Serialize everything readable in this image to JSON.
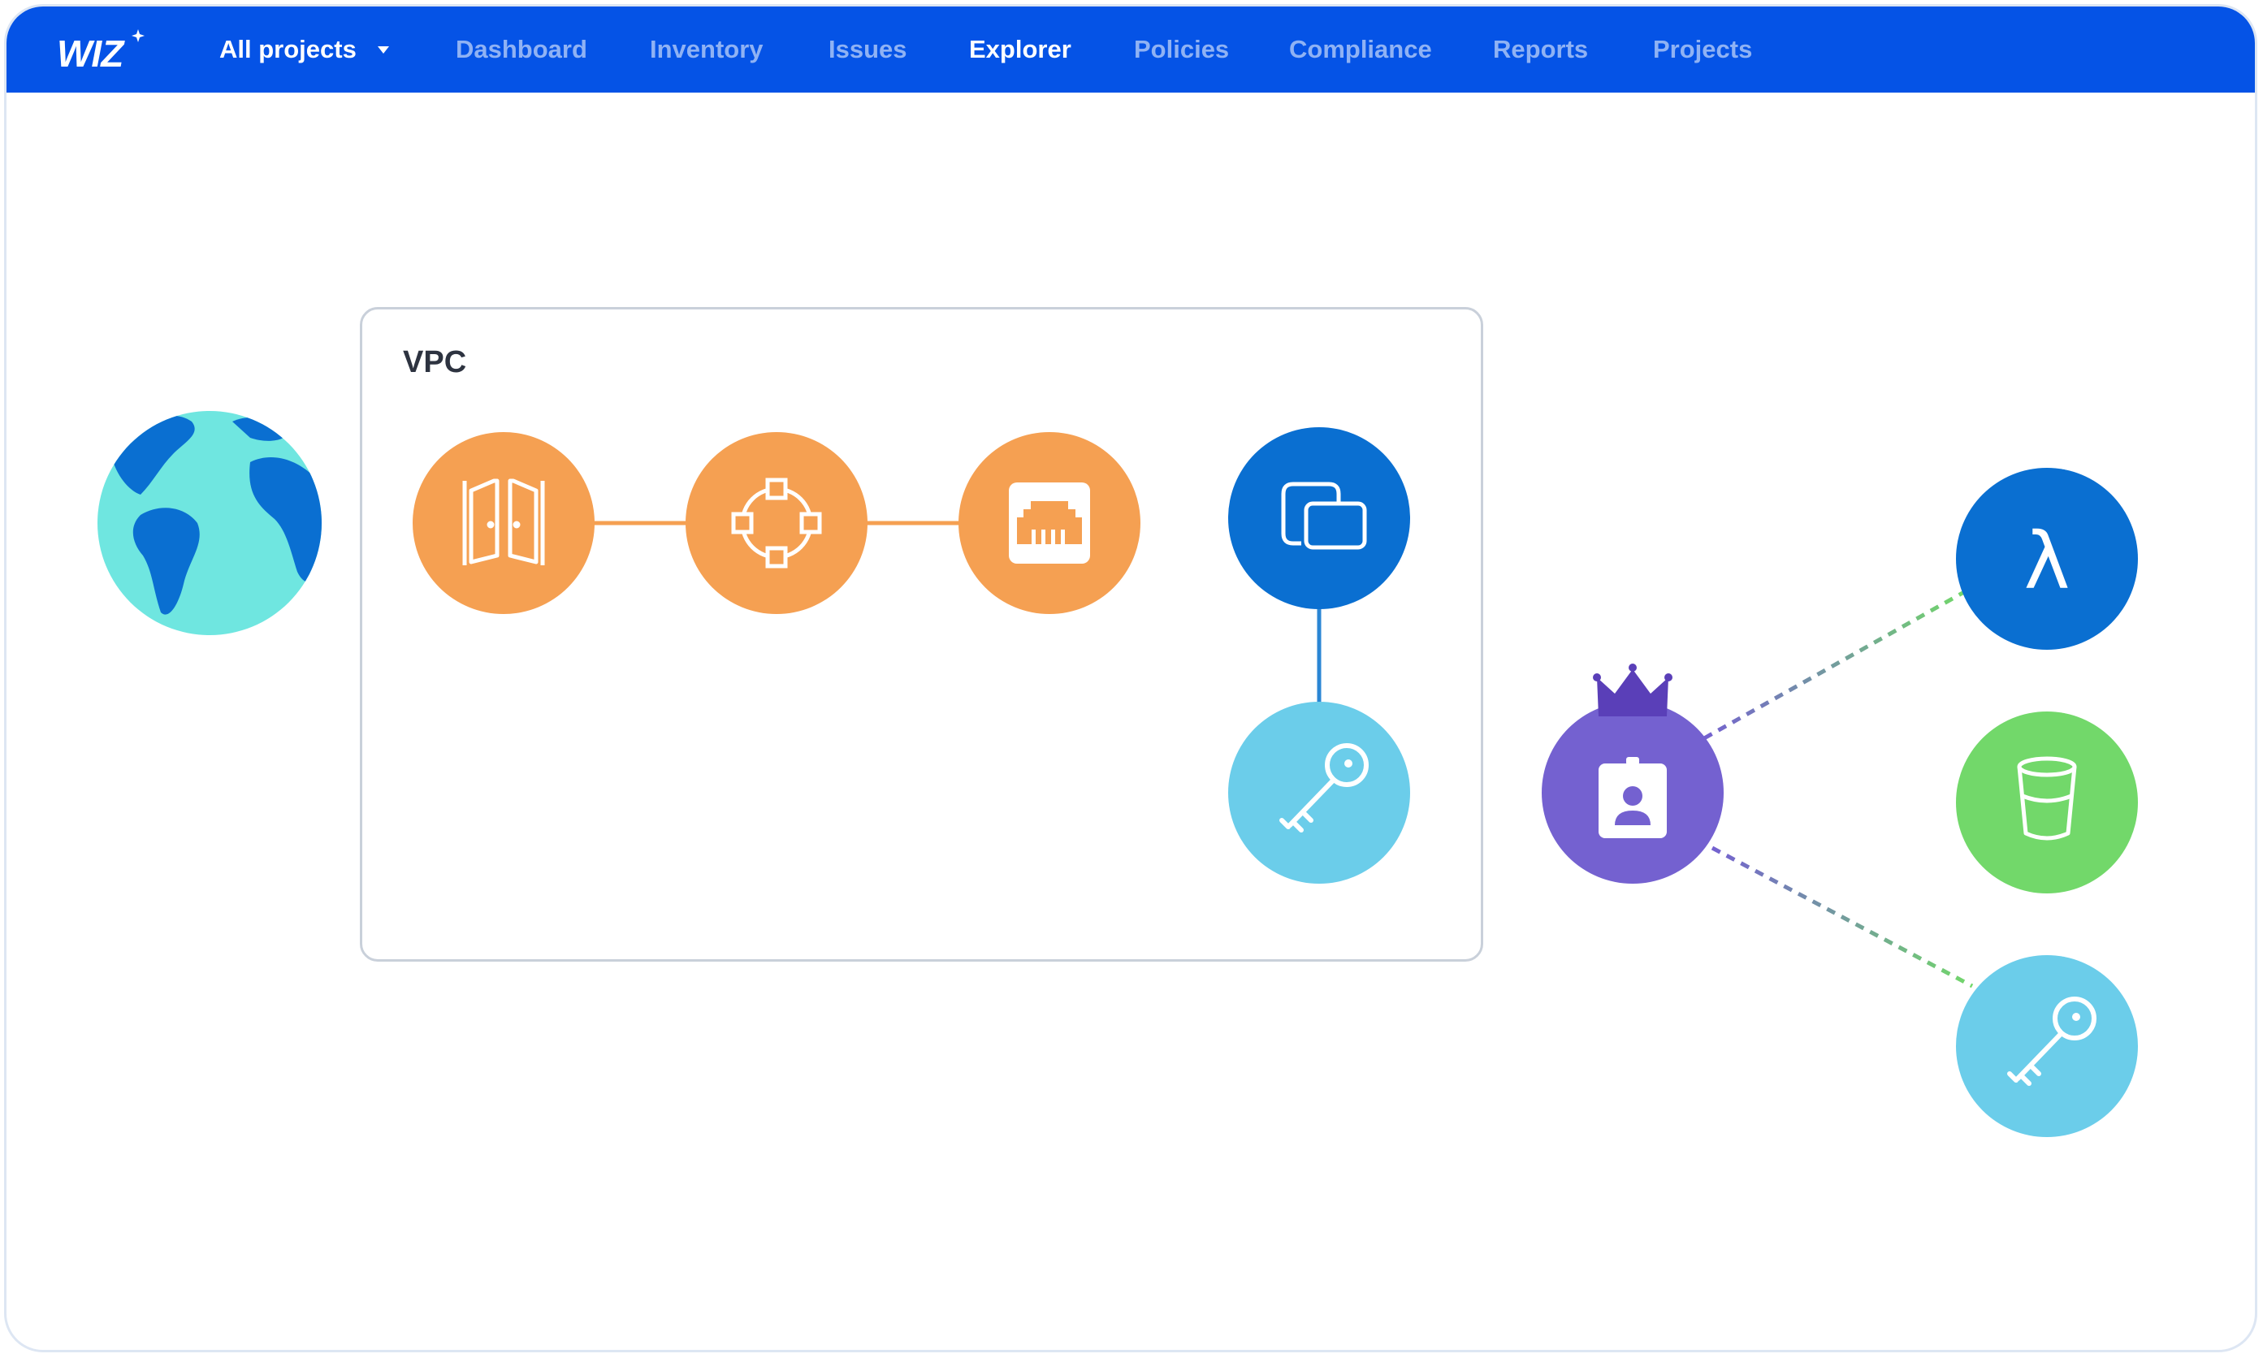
{
  "brand": {
    "logo_text": "WIZ"
  },
  "topbar": {
    "project_selector": "All projects",
    "nav": [
      "Dashboard",
      "Inventory",
      "Issues",
      "Explorer",
      "Policies",
      "Compliance",
      "Reports",
      "Projects"
    ],
    "active_nav": "Explorer"
  },
  "graph": {
    "group_label": "VPC",
    "nodes": [
      {
        "id": "internet",
        "icon": "globe-icon",
        "color": "#6fe6e0"
      },
      {
        "id": "gateway",
        "icon": "gate-icon",
        "color": "#f5a052"
      },
      {
        "id": "load-balancer",
        "icon": "network-hub-icon",
        "color": "#f5a052"
      },
      {
        "id": "network-interface",
        "icon": "ethernet-port-icon",
        "color": "#f5a052"
      },
      {
        "id": "virtual-machine",
        "icon": "vm-windows-icon",
        "color": "#0a6fd1"
      },
      {
        "id": "access-key",
        "icon": "key-icon",
        "color": "#6bcdea"
      },
      {
        "id": "admin-identity",
        "icon": "id-badge-icon",
        "color": "#7461d0",
        "badge": "crown-icon"
      },
      {
        "id": "serverless-function",
        "icon": "lambda-icon",
        "color": "#0a6fd1"
      },
      {
        "id": "storage-bucket",
        "icon": "bucket-icon",
        "color": "#72d86a"
      },
      {
        "id": "secret-key",
        "icon": "key-icon",
        "color": "#6bcdea"
      }
    ]
  },
  "colors": {
    "topbar": "#0553e6",
    "accent_orange": "#f5a052",
    "blue_dark": "#0a6fd1",
    "purple": "#7461d0",
    "green": "#72d86a",
    "light_blue": "#6bcdea"
  }
}
